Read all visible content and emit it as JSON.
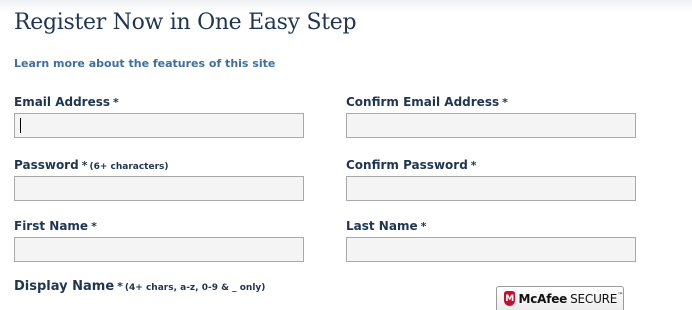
{
  "header": {
    "title": "Register Now in One Easy Step",
    "learn_more_link": "Learn more about the features of this site"
  },
  "form": {
    "email": {
      "label": "Email Address",
      "required": "*",
      "value": ""
    },
    "confirm_email": {
      "label": "Confirm Email Address",
      "required": "*",
      "value": ""
    },
    "password": {
      "label": "Password",
      "required": "*",
      "hint": "(6+ characters)",
      "value": ""
    },
    "confirm_password": {
      "label": "Confirm Password",
      "required": "*",
      "value": ""
    },
    "first_name": {
      "label": "First Name",
      "required": "*",
      "value": ""
    },
    "last_name": {
      "label": "Last Name",
      "required": "*",
      "value": ""
    },
    "display_name": {
      "label": "Display Name",
      "required": "*",
      "hint": "(4+ chars, a-z, 0-9 & _ only)"
    }
  },
  "badge": {
    "brand": "McAfee",
    "secure": "SECURE",
    "trademark": "™",
    "icon": "mcafee-shield-icon",
    "brand_color": "#c8102e"
  },
  "colors": {
    "heading": "#1f3552",
    "link": "#3f6f9e",
    "input_bg": "#f4f4f4",
    "input_border": "#a9a9a9"
  }
}
